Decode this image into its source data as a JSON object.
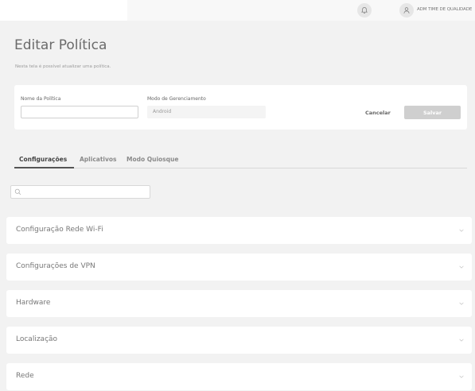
{
  "header": {
    "user_name": "ADM TIME DE QUALIDADE",
    "icons": [
      "bell-icon",
      "user-icon"
    ]
  },
  "page": {
    "title": "Editar Política",
    "subtitle": "Nesta tela é possível atualizar uma política."
  },
  "form": {
    "name_label": "Nome da Política",
    "name_value": "",
    "mode_label": "Modo de Gerenciamento",
    "mode_value": "Android",
    "cancel_label": "Cancelar",
    "save_label": "Salvar"
  },
  "tabs": [
    {
      "label": "Configurações",
      "active": true
    },
    {
      "label": "Aplicativos",
      "active": false
    },
    {
      "label": "Modo Quiosque",
      "active": false
    }
  ],
  "search": {
    "placeholder": "",
    "icon": "search-icon"
  },
  "sections": [
    {
      "title": "Configuração Rede Wi-Fi"
    },
    {
      "title": "Configurações de VPN"
    },
    {
      "title": "Hardware"
    },
    {
      "title": "Localização"
    },
    {
      "title": "Rede"
    }
  ],
  "colors": {
    "background": "#f2f2f2",
    "card": "#ffffff",
    "save_disabled": "#cfcfcf",
    "active_tab": "#444444"
  }
}
